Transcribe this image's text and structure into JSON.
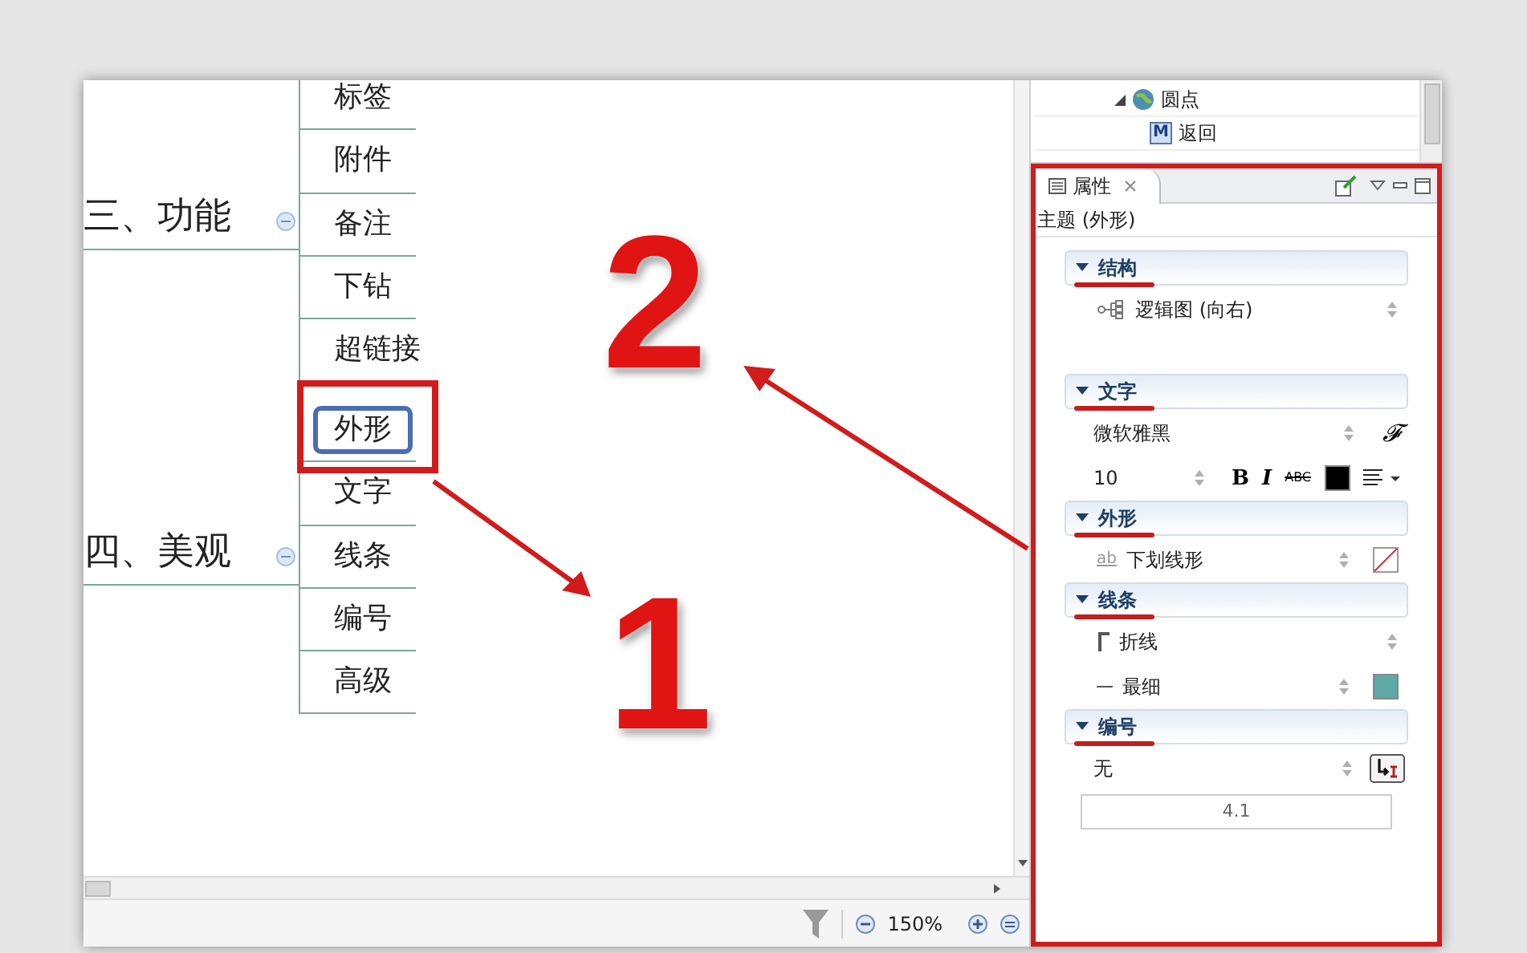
{
  "outline": {
    "items": [
      {
        "label": "圆点",
        "expanded": true,
        "children": [
          {
            "label": "返回",
            "icon_text": "M"
          }
        ]
      }
    ]
  },
  "mindmap": {
    "branches": [
      {
        "label": "三、功能",
        "expanded": true,
        "children": [
          {
            "label": "标签",
            "selected": false
          },
          {
            "label": "附件",
            "selected": false
          },
          {
            "label": "备注",
            "selected": false
          },
          {
            "label": "下钻",
            "selected": false
          },
          {
            "label": "超链接",
            "selected": false
          }
        ]
      },
      {
        "label": "四、美观",
        "expanded": true,
        "children": [
          {
            "label": "外形",
            "selected": true
          },
          {
            "label": "文字",
            "selected": false
          },
          {
            "label": "线条",
            "selected": false
          },
          {
            "label": "编号",
            "selected": false
          },
          {
            "label": "高级",
            "selected": false
          }
        ]
      }
    ]
  },
  "status_bar": {
    "zoom": "150%"
  },
  "properties": {
    "tab": "属性",
    "subtitle": "主题 (外形)",
    "sections": [
      {
        "title": "结构",
        "expanded": true,
        "rows": [
          {
            "kind": "structure",
            "value": "逻辑图 (向右)"
          }
        ]
      },
      {
        "title": "文字",
        "expanded": true,
        "rows": [
          {
            "kind": "font",
            "value": "微软雅黑",
            "icon_text": "𝓕"
          },
          {
            "kind": "size",
            "value": "10",
            "bold": "B",
            "italic": "I",
            "strike": "ABC",
            "color": "#000000"
          }
        ]
      },
      {
        "title": "外形",
        "expanded": true,
        "rows": [
          {
            "kind": "shape",
            "icon_text": "ab",
            "value": "下划线形"
          }
        ]
      },
      {
        "title": "线条",
        "expanded": true,
        "rows": [
          {
            "kind": "line",
            "value": "折线"
          },
          {
            "kind": "width",
            "value": "最细",
            "color": "#5fa8a8"
          }
        ]
      },
      {
        "title": "编号",
        "expanded": true,
        "rows": [
          {
            "kind": "numbering",
            "value": "无"
          },
          {
            "kind": "preview",
            "value": "4.1"
          }
        ]
      }
    ]
  },
  "annotations": [
    {
      "label": "2"
    },
    {
      "label": "1"
    }
  ]
}
